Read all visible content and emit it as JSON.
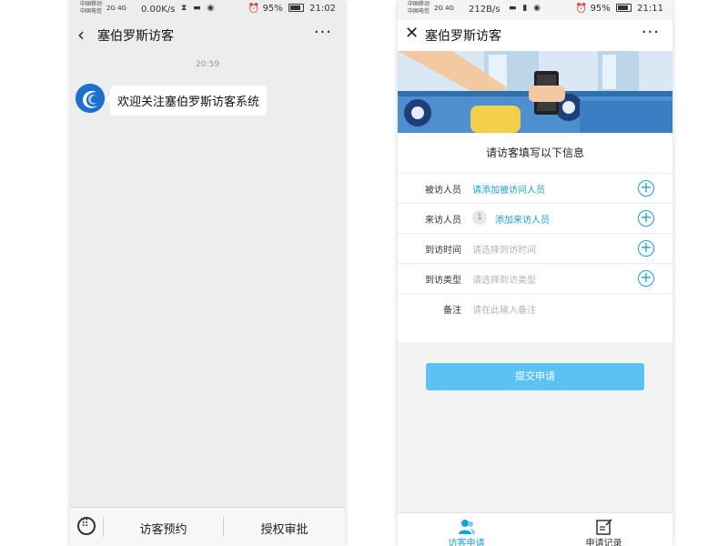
{
  "left_phone": {
    "status": {
      "carrier1": "中国移动",
      "carrier2": "中国电信",
      "network": "2G 4G",
      "speed": "0.00K/s",
      "battery": "95%",
      "time": "21:02"
    },
    "nav": {
      "title": "塞伯罗斯访客",
      "more": "···"
    },
    "chat": {
      "timestamp": "20:59",
      "message": "欢迎关注塞伯罗斯访客系统"
    },
    "menu": {
      "item1": "访客预约",
      "item2": "授权审批"
    }
  },
  "right_phone": {
    "status": {
      "carrier1": "中国移动",
      "carrier2": "中国电信",
      "network": "2G 4G",
      "speed": "212B/s",
      "battery": "95%",
      "time": "21:11"
    },
    "nav": {
      "title": "塞伯罗斯访客",
      "more": "···"
    },
    "form": {
      "heading": "请访客填写以下信息",
      "rows": [
        {
          "label": "被访人员",
          "value": "请添加被访问人员"
        },
        {
          "label": "来访人员",
          "badge": "1",
          "value": "添加来访人员"
        },
        {
          "label": "到访时间",
          "placeholder": "请选择到访时间"
        },
        {
          "label": "到访类型",
          "placeholder": "请选择到访类型"
        },
        {
          "label": "备注",
          "placeholder": "请在此输入备注"
        }
      ],
      "submit": "提交申请"
    },
    "tabs": [
      {
        "label": "访客申请",
        "icon": "users-icon"
      },
      {
        "label": "申请记录",
        "icon": "edit-record-icon"
      }
    ]
  },
  "colors": {
    "accent": "#1aa1d8",
    "submit_bg": "#5bc2f4",
    "chat_bg": "#ededed"
  }
}
